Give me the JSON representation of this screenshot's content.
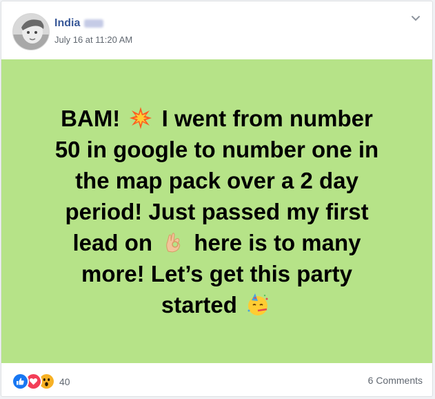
{
  "post": {
    "author_name": "India",
    "timestamp": "July 16 at 11:20 AM",
    "lines": [
      {
        "before": "BAM!",
        "emoji": "collision-emoji",
        "after": "I went from number"
      },
      {
        "before": "50 in google to number one in",
        "emoji": null,
        "after": ""
      },
      {
        "before": "the map pack over a 2 day",
        "emoji": null,
        "after": ""
      },
      {
        "before": "period! Just passed my first",
        "emoji": null,
        "after": ""
      },
      {
        "before": "lead on",
        "emoji": "ok-hand-emoji",
        "after": "here is to many"
      },
      {
        "before": "more! Let’s get this party",
        "emoji": null,
        "after": ""
      },
      {
        "before": "started",
        "emoji": "partying-face-emoji",
        "after": ""
      }
    ],
    "background_color": "#b6e388"
  },
  "footer": {
    "reaction_icons": [
      "like-reaction-icon",
      "love-reaction-icon",
      "wow-reaction-icon"
    ],
    "reaction_count": "40",
    "comments_label": "6 Comments"
  },
  "colors": {
    "author": "#385898",
    "meta": "#606770",
    "like": "#1877f2",
    "love": "#f33e58",
    "wow": "#f7b125"
  }
}
